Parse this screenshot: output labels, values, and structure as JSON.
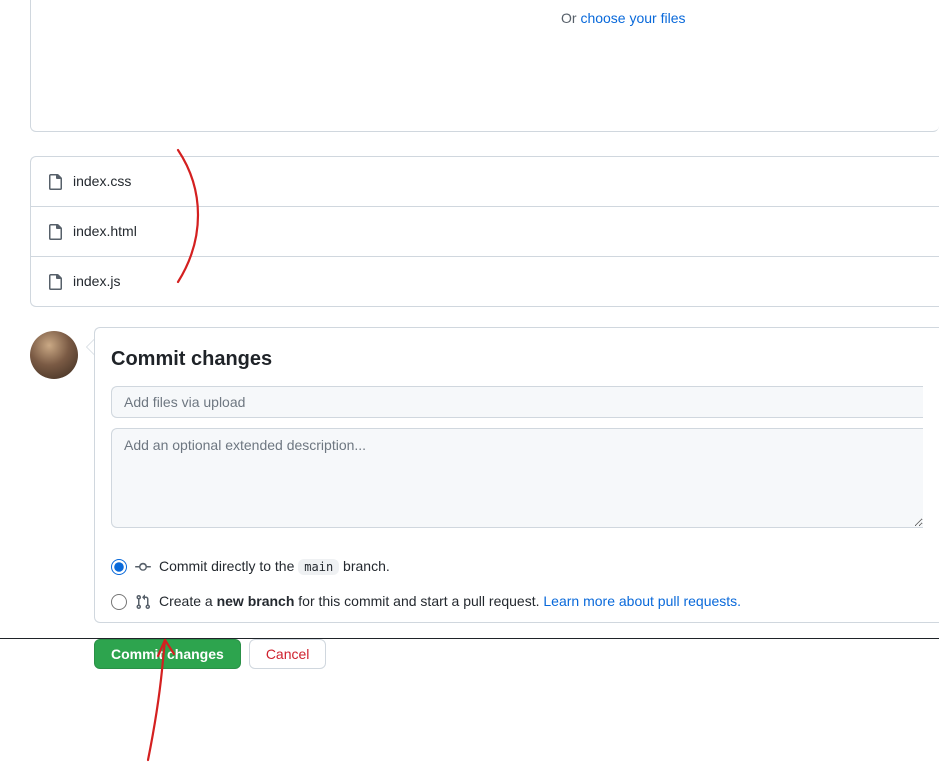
{
  "dropArea": {
    "orText": "Or ",
    "chooseLink": "choose your files"
  },
  "files": [
    {
      "name": "index.css"
    },
    {
      "name": "index.html"
    },
    {
      "name": "index.js"
    }
  ],
  "commit": {
    "title": "Commit changes",
    "summaryPlaceholder": "Add files via upload",
    "descPlaceholder": "Add an optional extended description...",
    "radioDirect": {
      "pre": "Commit directly to the ",
      "branch": "main",
      "post": " branch."
    },
    "radioNew": {
      "pre": "Create a ",
      "strong": "new branch",
      "post": " for this commit and start a pull request. ",
      "learn": "Learn more about pull requests."
    },
    "commitButton": "Commit changes",
    "cancelButton": "Cancel"
  }
}
